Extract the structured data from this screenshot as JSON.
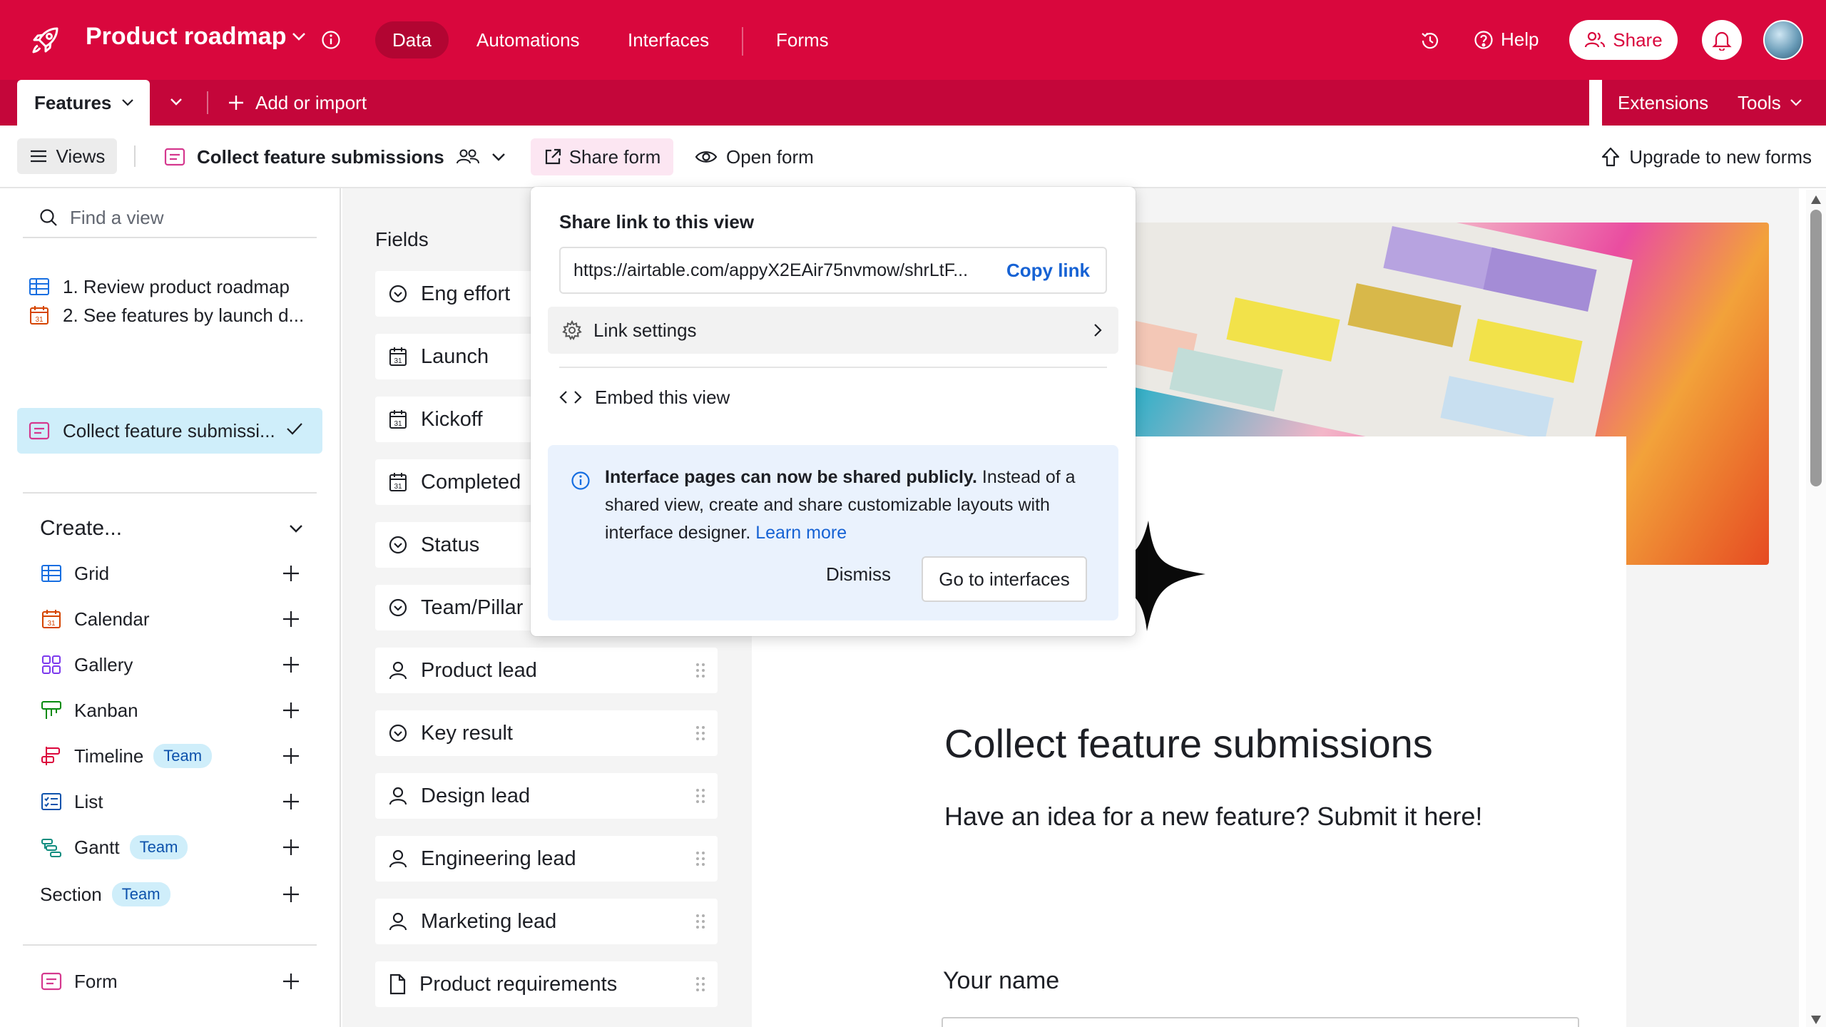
{
  "topbar": {
    "base_title": "Product roadmap",
    "nav": [
      "Data",
      "Automations",
      "Interfaces",
      "Forms"
    ],
    "help": "Help",
    "share": "Share",
    "bg_color": "#d9073d"
  },
  "table_tabs": {
    "active_table": "Features",
    "add_import": "Add or import",
    "extensions": "Extensions",
    "tools": "Tools"
  },
  "viewbar": {
    "views": "Views",
    "view_name": "Collect feature submissions",
    "share_form": "Share form",
    "open_form": "Open form",
    "upgrade": "Upgrade to new forms"
  },
  "sidebar": {
    "find_placeholder": "Find a view",
    "views": [
      {
        "label": "1. Review product roadmap",
        "icon": "grid-icon"
      },
      {
        "label": "2. See features by launch d...",
        "icon": "calendar-icon"
      },
      {
        "label": "Collect feature submissi...",
        "icon": "form-icon",
        "active": true
      }
    ],
    "create_label": "Create...",
    "create_items": [
      {
        "label": "Grid",
        "icon": "grid-icon"
      },
      {
        "label": "Calendar",
        "icon": "calendar-icon"
      },
      {
        "label": "Gallery",
        "icon": "gallery-icon"
      },
      {
        "label": "Kanban",
        "icon": "kanban-icon"
      },
      {
        "label": "Timeline",
        "icon": "timeline-icon",
        "badge": "Team"
      },
      {
        "label": "List",
        "icon": "list-icon"
      },
      {
        "label": "Gantt",
        "icon": "gantt-icon",
        "badge": "Team"
      },
      {
        "label": "Section",
        "badge": "Team"
      },
      {
        "label": "Form",
        "icon": "form-icon"
      }
    ]
  },
  "fields": {
    "title": "Fields",
    "items": [
      {
        "label": "Eng effort",
        "icon": "single-select-icon"
      },
      {
        "label": "Launch",
        "icon": "date-icon"
      },
      {
        "label": "Kickoff",
        "icon": "date-icon"
      },
      {
        "label": "Completed",
        "icon": "date-icon"
      },
      {
        "label": "Status",
        "icon": "single-select-icon"
      },
      {
        "label": "Team/Pillar",
        "icon": "single-select-icon"
      },
      {
        "label": "Product lead",
        "icon": "user-icon"
      },
      {
        "label": "Key result",
        "icon": "single-select-icon"
      },
      {
        "label": "Design lead",
        "icon": "user-icon"
      },
      {
        "label": "Engineering lead",
        "icon": "user-icon"
      },
      {
        "label": "Marketing lead",
        "icon": "user-icon"
      },
      {
        "label": "Product requirements",
        "icon": "document-icon"
      }
    ]
  },
  "form_preview": {
    "title": "Collect feature submissions",
    "description": "Have an idea for a new feature? Submit it here!",
    "first_field": "Your name"
  },
  "share_popover": {
    "title": "Share link to this view",
    "url": "https://airtable.com/appyX2EAir75nvmow/shrLtF...",
    "copy_link": "Copy link",
    "link_settings": "Link settings",
    "embed": "Embed this view",
    "notice_bold": "Interface pages can now be shared publicly.",
    "notice_text": " Instead of a shared view, create and share customizable layouts with interface designer. ",
    "learn_more": "Learn more",
    "dismiss": "Dismiss",
    "go_to_interfaces": "Go to interfaces"
  }
}
